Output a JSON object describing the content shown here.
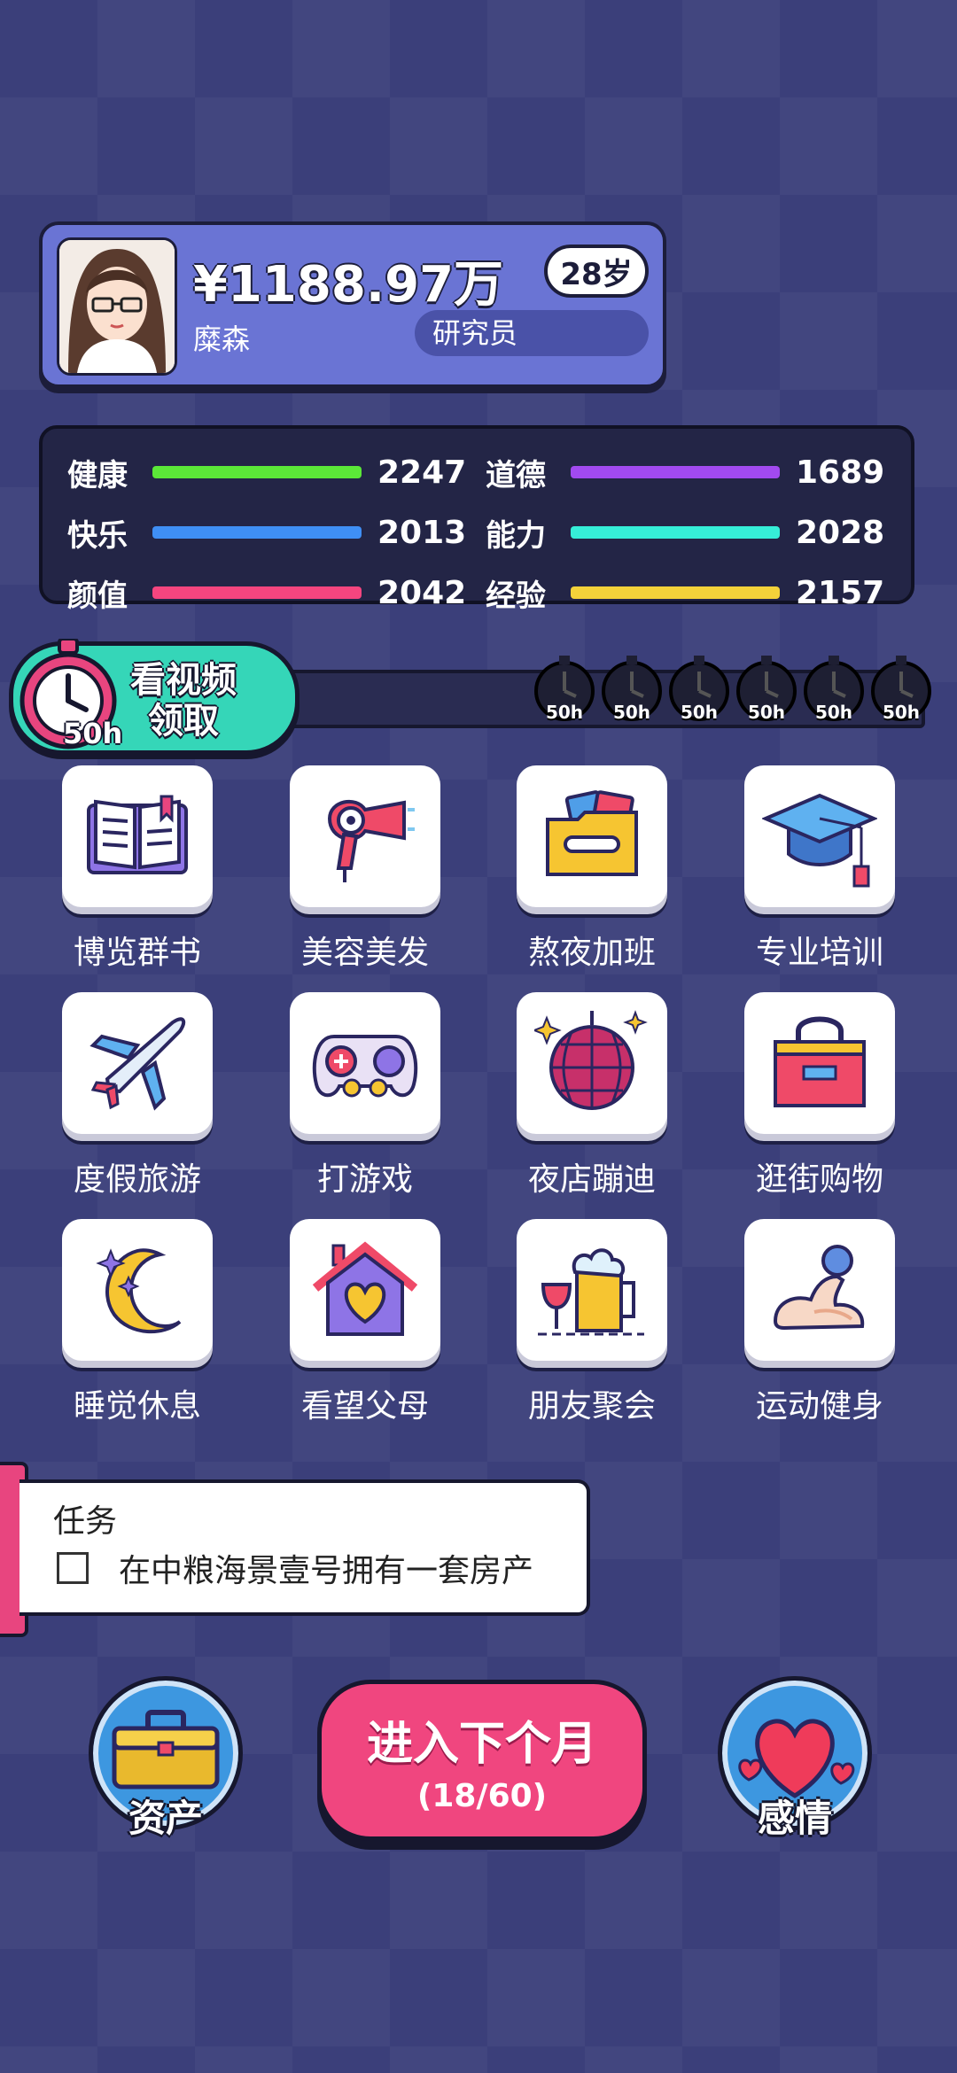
{
  "profile": {
    "money": "¥1188.97万",
    "age": "28岁",
    "name": "糜森",
    "job": "研究员"
  },
  "stats": [
    {
      "label": "健康",
      "value": "2247",
      "color": "#5be838"
    },
    {
      "label": "快乐",
      "value": "2013",
      "color": "#3f8ff5"
    },
    {
      "label": "颜值",
      "value": "2042",
      "color": "#f5457f"
    },
    {
      "label": "道德",
      "value": "1689",
      "color": "#a24af0"
    },
    {
      "label": "能力",
      "value": "2028",
      "color": "#36eed8"
    },
    {
      "label": "经验",
      "value": "2157",
      "color": "#f3d23a"
    }
  ],
  "video": {
    "label_line1": "看视频",
    "label_line2": "领取",
    "badge": "50h",
    "timers": [
      "50h",
      "50h",
      "50h",
      "50h",
      "50h",
      "50h"
    ]
  },
  "activities": [
    {
      "label": "博览群书",
      "icon": "book-icon"
    },
    {
      "label": "美容美发",
      "icon": "hair-dryer-icon"
    },
    {
      "label": "熬夜加班",
      "icon": "folder-icon"
    },
    {
      "label": "专业培训",
      "icon": "graduation-cap-icon"
    },
    {
      "label": "度假旅游",
      "icon": "airplane-icon"
    },
    {
      "label": "打游戏",
      "icon": "gamepad-icon"
    },
    {
      "label": "夜店蹦迪",
      "icon": "disco-ball-icon"
    },
    {
      "label": "逛街购物",
      "icon": "shopping-bag-icon"
    },
    {
      "label": "睡觉休息",
      "icon": "moon-icon"
    },
    {
      "label": "看望父母",
      "icon": "house-heart-icon"
    },
    {
      "label": "朋友聚会",
      "icon": "beer-icon"
    },
    {
      "label": "运动健身",
      "icon": "muscle-icon"
    }
  ],
  "task": {
    "title": "任务",
    "item": "在中粮海景壹号拥有一套房产"
  },
  "bottom": {
    "assets": "资产",
    "next_main": "进入下个月",
    "next_sub": "(18/60)",
    "love": "感情"
  }
}
